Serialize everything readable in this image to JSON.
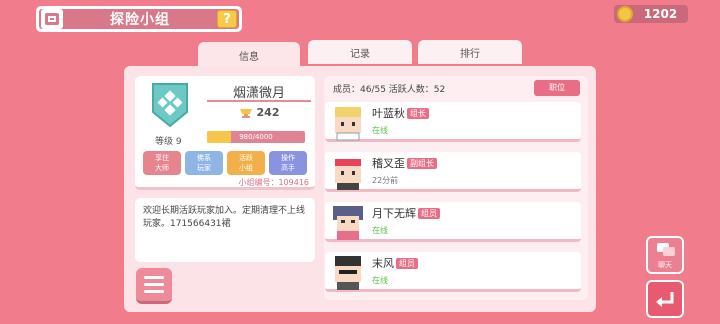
{
  "header": {
    "title": "探险小组",
    "help_label": "?",
    "coins": "1202"
  },
  "tabs": [
    {
      "label": "信息",
      "active": true
    },
    {
      "label": "记录",
      "active": false
    },
    {
      "label": "排行",
      "active": false
    }
  ],
  "clan": {
    "name": "烟潇微月",
    "score": "242",
    "level_label": "等级 9",
    "exp_text": "980/4000",
    "exp_progress": 0.245,
    "clan_id_label": "小组编号：109416",
    "tags": [
      {
        "line1": "享住",
        "line2": "大师",
        "color": "#e7858f"
      },
      {
        "line1": "佛系",
        "line2": "玩家",
        "color": "#8fb5e6"
      },
      {
        "line1": "活跃",
        "line2": "小组",
        "color": "#f3b04a"
      },
      {
        "line1": "操作",
        "line2": "高手",
        "color": "#8a93e0"
      }
    ]
  },
  "notice": "欢迎长期活跃玩家加入。定期清理不上线玩家。171566431裙",
  "stats": {
    "text": "成员：46/55  活跃人数：52"
  },
  "role_button": "职位",
  "members": [
    {
      "name": "叶蓝秋",
      "role": "组长",
      "status": "在线",
      "status_color": "#5cc24a"
    },
    {
      "name": "稽叉歪",
      "role": "副组长",
      "status": "22分前",
      "status_color": "#777777"
    },
    {
      "name": "月下无辉",
      "role": "组员",
      "status": "在线",
      "status_color": "#5cc24a"
    },
    {
      "name": "末风",
      "role": "组员",
      "status": "在线",
      "status_color": "#5cc24a"
    }
  ],
  "chat_label": "聊天",
  "colors": {
    "background": "#f07c8c",
    "accent": "#e96e85",
    "gold": "#f5c64a"
  }
}
